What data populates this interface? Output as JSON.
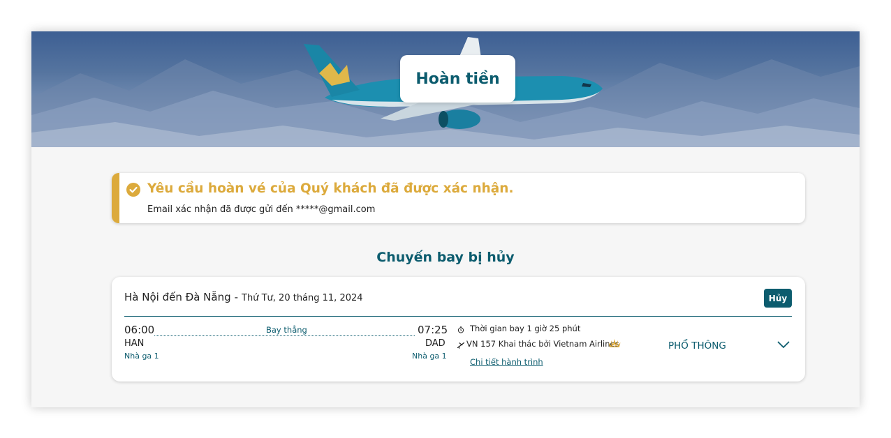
{
  "header": {
    "title": "Hoàn tiền"
  },
  "alert": {
    "icon": "check-circle-icon",
    "accent_color": "#dcaa3c",
    "headline": "Yêu cầu hoàn vé của Quý khách đã được xác nhận.",
    "message": "Email xác nhận đã được gửi đến *****@gmail.com"
  },
  "section": {
    "title": "Chuyến bay bị hủy"
  },
  "flight": {
    "route": "Hà Nội đến Đà Nẵng",
    "separator": "-",
    "date": "Thứ Tư, 20 tháng 11, 2024",
    "status_badge": "Hủy",
    "departure": {
      "time": "06:00",
      "code": "HAN",
      "terminal": "Nhà ga 1"
    },
    "arrival": {
      "time": "07:25",
      "code": "DAD",
      "terminal": "Nhà ga 1"
    },
    "stops_label": "Bay thẳng",
    "duration": "Thời gian bay 1 giờ 25 phút",
    "flight_info": "VN 157 Khai thác bởi Vietnam Airlines",
    "details_link": "Chi tiết hành trình",
    "cabin": "PHỔ THÔNG"
  },
  "colors": {
    "primary": "#0c5c6e",
    "gold": "#dcaa3c",
    "background": "#f6f6f6"
  }
}
